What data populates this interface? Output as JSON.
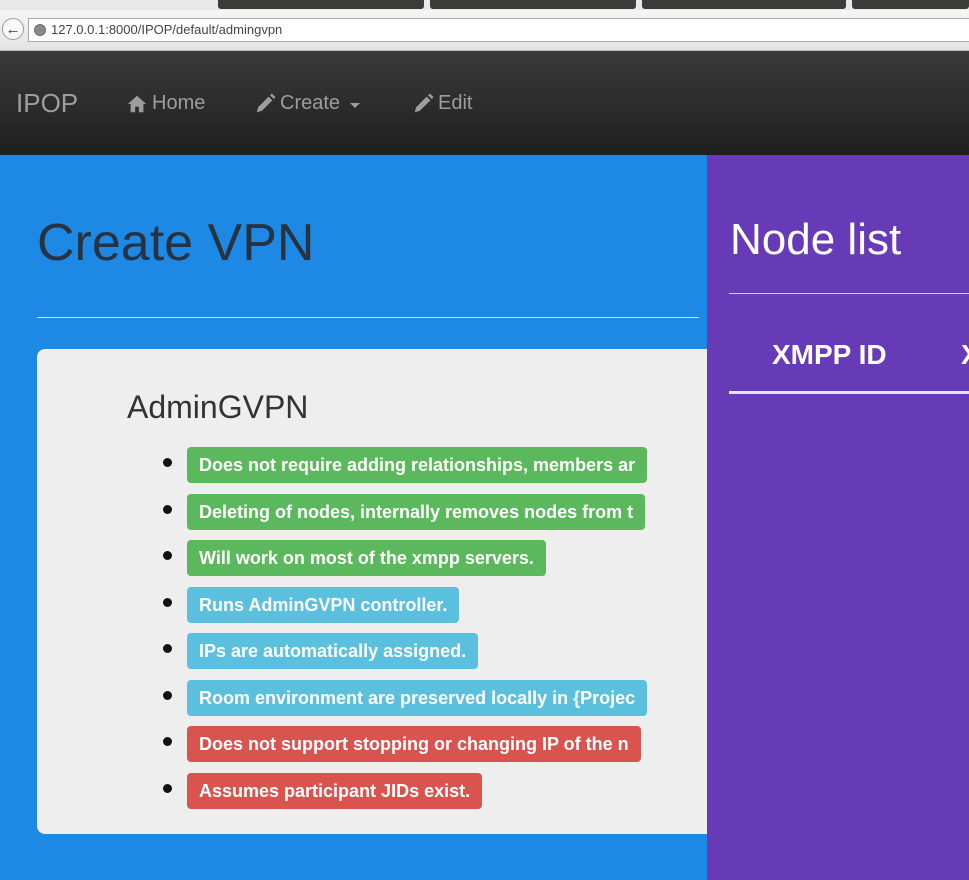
{
  "browser": {
    "url": "127.0.0.1:8000/IPOP/default/admingvpn"
  },
  "navbar": {
    "brand": "IPOP",
    "items": [
      {
        "label": "Home",
        "icon": "home-icon"
      },
      {
        "label": "Create",
        "icon": "pencil-icon",
        "dropdown": true
      },
      {
        "label": "Edit",
        "icon": "pencil-icon"
      }
    ]
  },
  "main": {
    "title": "Create VPN",
    "vpn_name": "AdminGVPN",
    "features": [
      {
        "text": "Does not require adding relationships, members ar",
        "status": "success"
      },
      {
        "text": "Deleting of nodes, internally removes nodes from t",
        "status": "success"
      },
      {
        "text": "Will work on most of the xmpp servers.",
        "status": "success"
      },
      {
        "text": "Runs AdminGVPN controller.",
        "status": "info"
      },
      {
        "text": "IPs are automatically assigned.",
        "status": "info"
      },
      {
        "text": "Room environment are preserved locally in {Projec",
        "status": "info"
      },
      {
        "text": "Does not support stopping or changing IP of the n",
        "status": "danger"
      },
      {
        "text": "Assumes participant JIDs exist.",
        "status": "danger"
      }
    ]
  },
  "node_list": {
    "title": "Node list",
    "columns": [
      "XMPP ID",
      "X"
    ]
  },
  "colors": {
    "left_bg": "#1e88e5",
    "right_bg": "#673ab7",
    "success": "#5cb85c",
    "info": "#5bc0de",
    "danger": "#d9534f"
  }
}
